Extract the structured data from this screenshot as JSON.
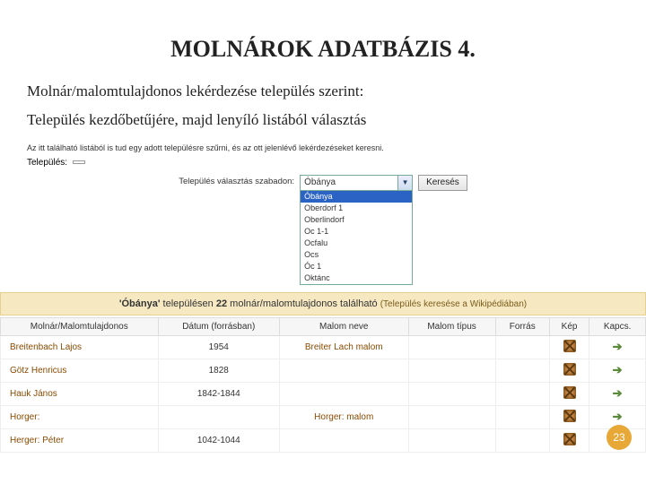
{
  "title": "MOLNÁROK ADATBÁZIS 4.",
  "desc_line1": "Molnár/malomtulajdonos lekérdezése település szerint:",
  "desc_line2": "Település kezdőbetűjére, majd lenyíló listából választás",
  "top_hint": "Az itt található listából is tud egy adott településre szűrni, és az ott jelenlévő lekérdezéseket keresni.",
  "tel_label": "Település:",
  "tel_value": "",
  "search_label": "Település választás szabadon:",
  "combo_value": "Óbánya",
  "search_btn": "Keresés",
  "dropdown": [
    "Óbánya",
    "Oberdorf 1",
    "Oberlindorf",
    "Oc 1-1",
    "Ocfalu",
    "Ocs",
    "Óc 1",
    "Oktánc"
  ],
  "result_prefix": "'Óbánya'",
  "result_mid": " településen ",
  "result_count": "22",
  "result_suffix": " molnár/malomtulajdonos található ",
  "wiki_text": "(Település keresése a Wikipédiában)",
  "cols": [
    "Molnár/Malomtulajdonos",
    "Dátum (forrásban)",
    "Malom neve",
    "Malom típus",
    "Forrás",
    "Kép",
    "Kapcs."
  ],
  "rows": [
    {
      "name": "Breitenbach Lajos",
      "date": "1954",
      "malom": "Breiter Lach malom"
    },
    {
      "name": "Götz Henricus",
      "date": "1828",
      "malom": ""
    },
    {
      "name": "Hauk János",
      "date": "1842-1844",
      "malom": ""
    },
    {
      "name": "Horger:",
      "date": "",
      "malom": "Horger: malom"
    },
    {
      "name": "Herger: Péter",
      "date": "1042-1044",
      "malom": ""
    }
  ],
  "page_num": "23"
}
